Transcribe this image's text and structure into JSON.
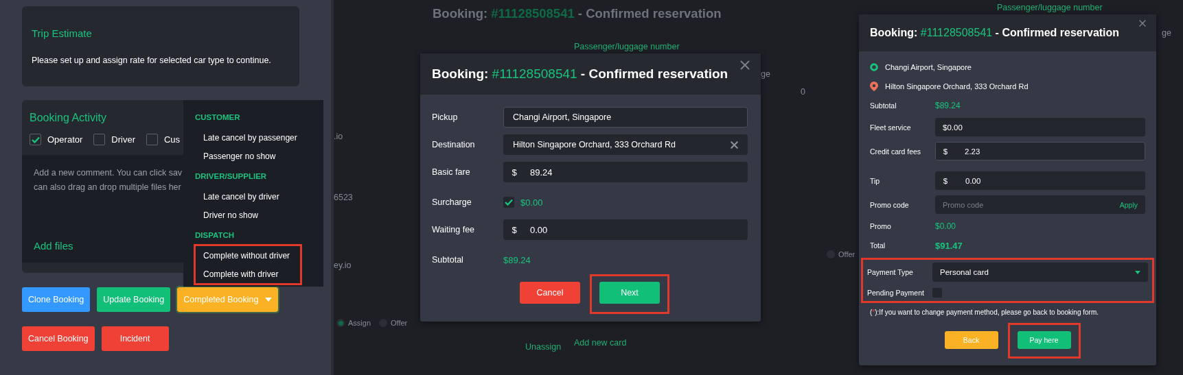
{
  "left_panel": {
    "trip_estimate": {
      "title": "Trip Estimate",
      "message": "Please set up and assign rate for selected car type to continue."
    },
    "booking_activity": {
      "title": "Booking Activity",
      "filters": [
        {
          "label": "Operator",
          "checked": true
        },
        {
          "label": "Driver",
          "checked": false
        },
        {
          "label": "Cus",
          "checked": false
        }
      ],
      "comment_lines": [
        "Add a new comment. You can click sav",
        "can also drag an drop multiple files her"
      ],
      "add_files": "Add files"
    },
    "dropdown": {
      "sections": [
        {
          "heading": "CUSTOMER",
          "highlighted": false,
          "items": [
            "Late cancel by passenger",
            "Passenger no show"
          ]
        },
        {
          "heading": "DRIVER/SUPPLIER",
          "highlighted": false,
          "items": [
            "Late cancel by driver",
            "Driver no show"
          ]
        },
        {
          "heading": "DISPATCH",
          "highlighted": true,
          "items": [
            "Complete without driver",
            "Complete with driver"
          ]
        }
      ]
    },
    "button_rows": [
      [
        {
          "label": "Clone Booking",
          "kind": "info",
          "caret": false
        },
        {
          "label": "Update Booking",
          "kind": "success",
          "caret": false
        },
        {
          "label": "Completed Booking",
          "kind": "warning",
          "caret": true
        }
      ],
      [
        {
          "label": "Cancel Booking",
          "kind": "danger",
          "caret": false
        },
        {
          "label": "Incident",
          "kind": "danger",
          "caret": false
        }
      ]
    ]
  },
  "middle_panel": {
    "background": {
      "title": {
        "prefix": "Booking: ",
        "number": "#11128508541",
        "suffix": " - Confirmed reservation"
      },
      "texts": [
        {
          "text": "Passenger/luggage number",
          "kind": "link"
        },
        {
          "text": ".io",
          "kind": "value"
        },
        {
          "text": "6523",
          "kind": "value"
        },
        {
          "text": "ey.io",
          "kind": "value"
        },
        {
          "text": "Assign",
          "kind": "radio",
          "selected": true
        },
        {
          "text": "Offer",
          "kind": "radio",
          "selected": false
        },
        {
          "text": "Unassign",
          "kind": "link"
        },
        {
          "text": "Add new card",
          "kind": "link"
        }
      ]
    },
    "modal": {
      "title": {
        "prefix": "Booking: ",
        "number": "#11128508541",
        "suffix": " - Confirmed reservation"
      },
      "rows": [
        {
          "label": "Pickup",
          "kind": "text",
          "value": "Changi Airport, Singapore"
        },
        {
          "label": "Destination",
          "kind": "clearable",
          "value": "Hilton Singapore Orchard, 333 Orchard Rd"
        },
        {
          "label": "Basic fare",
          "kind": "money",
          "currency": "$",
          "value": "89.24"
        },
        {
          "label": "Surcharge",
          "kind": "check",
          "checked": true,
          "value": "$0.00"
        },
        {
          "label": "Waiting fee",
          "kind": "money",
          "currency": "$",
          "value": "0.00"
        },
        {
          "label": "Subtotal",
          "kind": "amount",
          "value": "$89.24"
        }
      ],
      "buttons": [
        {
          "label": "Cancel",
          "kind": "danger",
          "highlighted": false
        },
        {
          "label": "Next",
          "kind": "success",
          "highlighted": true
        }
      ]
    }
  },
  "right_panel": {
    "background": {
      "texts": [
        {
          "text": "ge",
          "kind": "value"
        },
        {
          "text": "0",
          "kind": "value"
        },
        {
          "text": "Offer",
          "kind": "radio",
          "selected": false
        },
        {
          "text": "Passenger/luggage number",
          "kind": "link"
        },
        {
          "text": "ge",
          "kind": "value"
        }
      ]
    },
    "modal": {
      "title": {
        "prefix": "Booking: ",
        "number": "#11128508541",
        "suffix": " - Confirmed reservation"
      },
      "route": [
        {
          "kind": "pickup",
          "text": "Changi Airport, Singapore"
        },
        {
          "kind": "dropoff",
          "text": "Hilton Singapore Orchard, 333 Orchard Rd"
        }
      ],
      "rows": [
        {
          "label": "Subtotal",
          "kind": "amount",
          "value": "$89.24"
        },
        {
          "label": "Fleet service",
          "kind": "text",
          "value": "$0.00"
        },
        {
          "label": "Credit card fees",
          "kind": "money",
          "currency": "$",
          "value": "2.23"
        },
        {
          "label": "Tip",
          "kind": "money",
          "currency": "$",
          "value": "0.00"
        },
        {
          "label": "Promo code",
          "kind": "promo",
          "placeholder": "Promo code",
          "action": "Apply"
        },
        {
          "label": "Promo",
          "kind": "amount",
          "value": "$0.00"
        },
        {
          "label": "Total",
          "kind": "total",
          "value": "$91.47"
        }
      ],
      "payment": {
        "highlighted": true,
        "type_label": "Payment Type",
        "type_value": "Personal card",
        "pending_label": "Pending Payment",
        "pending_checked": false
      },
      "note": {
        "open": "(",
        "mark": "*",
        "rest": "):If you want to change payment method, please go back to booking form."
      },
      "buttons": [
        {
          "label": "Back",
          "kind": "warning",
          "highlighted": false
        },
        {
          "label": "Pay here",
          "kind": "success",
          "highlighted": true
        }
      ]
    }
  }
}
